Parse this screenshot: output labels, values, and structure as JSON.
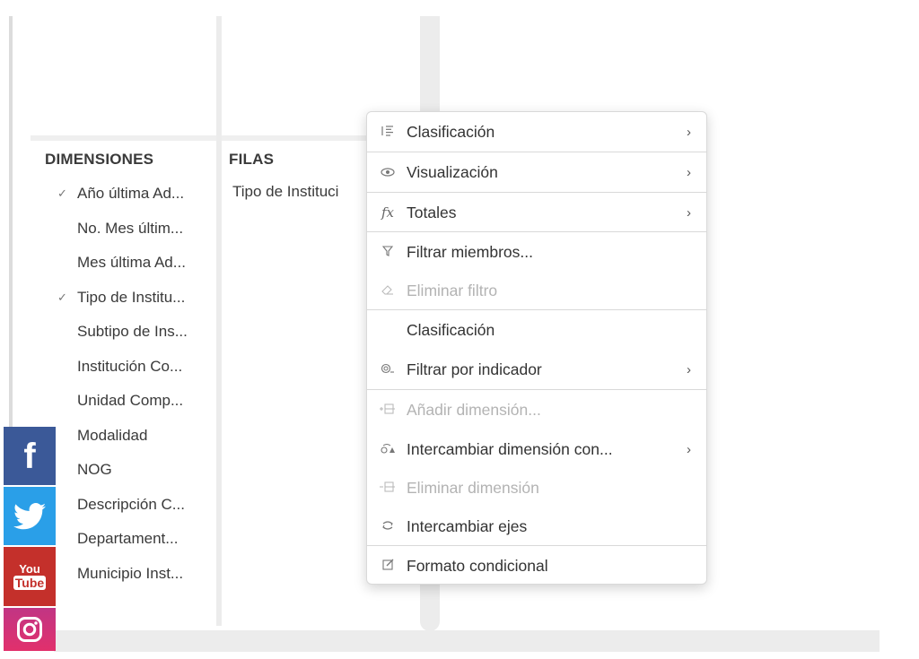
{
  "columns": {
    "dimensions_header": "DIMENSIONES",
    "rows_header": "FILAS"
  },
  "dimensions": [
    {
      "label": "Año última Ad...",
      "checked": true
    },
    {
      "label": "No. Mes últim...",
      "checked": false
    },
    {
      "label": "Mes última Ad...",
      "checked": false
    },
    {
      "label": "Tipo de Institu...",
      "checked": true
    },
    {
      "label": "Subtipo de Ins...",
      "checked": false
    },
    {
      "label": "Institución Co...",
      "checked": false
    },
    {
      "label": "Unidad Comp...",
      "checked": false
    },
    {
      "label": "Modalidad",
      "checked": false
    },
    {
      "label": "NOG",
      "checked": false
    },
    {
      "label": "Descripción C...",
      "checked": false
    },
    {
      "label": "Departament...",
      "checked": false
    },
    {
      "label": "Municipio Inst...",
      "checked": false
    }
  ],
  "check_mark": "✓",
  "rows": [
    {
      "label": "Tipo de Instituci"
    }
  ],
  "context_menu": {
    "items": [
      {
        "label": "Clasificación",
        "icon": "sort-icon",
        "submenu": true,
        "disabled": false
      },
      {
        "label": "Visualización",
        "icon": "eye-icon",
        "submenu": true,
        "disabled": false
      },
      {
        "label": "Totales",
        "icon": "fx-icon",
        "submenu": true,
        "disabled": false
      },
      {
        "label": "Filtrar miembros...",
        "icon": "filter-icon",
        "submenu": false,
        "disabled": false
      },
      {
        "label": "Eliminar filtro",
        "icon": "eraser-icon",
        "submenu": false,
        "disabled": true
      },
      {
        "label": "Clasificación",
        "icon": "",
        "submenu": false,
        "disabled": false
      },
      {
        "label": "Filtrar por indicador",
        "icon": "indicator-filter-icon",
        "submenu": true,
        "disabled": false
      },
      {
        "label": "Añadir dimensión...",
        "icon": "add-dimension-icon",
        "submenu": false,
        "disabled": true
      },
      {
        "label": "Intercambiar dimensión con...",
        "icon": "swap-dimension-icon",
        "submenu": true,
        "disabled": false
      },
      {
        "label": "Eliminar dimensión",
        "icon": "remove-dimension-icon",
        "submenu": false,
        "disabled": true
      },
      {
        "label": "Intercambiar ejes",
        "icon": "swap-axes-icon",
        "submenu": false,
        "disabled": false
      },
      {
        "label": "Formato condicional",
        "icon": "edit-format-icon",
        "submenu": false,
        "disabled": false
      }
    ],
    "arrow": "›"
  },
  "social": {
    "facebook": "f",
    "youtube_top": "You",
    "youtube_bottom": "Tube"
  },
  "colors": {
    "facebook": "#3b5998",
    "twitter": "#2a9fe8",
    "youtube": "#c4302b",
    "instagram": "#c13584"
  }
}
